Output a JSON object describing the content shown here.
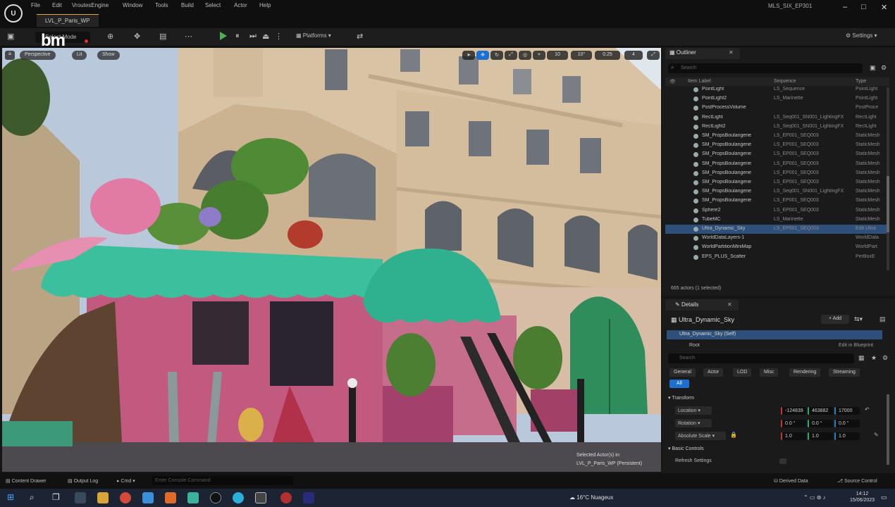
{
  "title_bar": {
    "menu": [
      "File",
      "Edit",
      "Window",
      "Tools",
      "Build",
      "Select",
      "Actor",
      "Help"
    ],
    "menu_partial": "VroutesEngine",
    "level_tab": "LVL_P_Paris_WP",
    "project": "MLS_SIX_EP301"
  },
  "toolbar": {
    "mode": "Select Mode",
    "watermark": "bm",
    "platforms": "Platforms",
    "settings": "Settings"
  },
  "viewport": {
    "perspective": "Perspective",
    "lit": "Lit",
    "show": "Show",
    "grid_snap": "10",
    "angle_snap": "10°",
    "scale_snap": "0.25",
    "camera_speed": "4",
    "overlay_line1": "Selected Actor(s) in:",
    "overlay_line2": "LVL_P_Paris_WP (Persistent)"
  },
  "outliner": {
    "tab": "Outliner",
    "search_placeholder": "Search",
    "col_item": "Item Label",
    "col_sequence": "Sequence",
    "col_type": "Type",
    "rows": [
      {
        "name": "PointLight",
        "seq": "LS_Sequence",
        "type": "PointLight"
      },
      {
        "name": "PointLight2",
        "seq": "LS_Marinette",
        "type": "PointLight"
      },
      {
        "name": "PostProcessVolume",
        "seq": "",
        "type": "PostProce"
      },
      {
        "name": "RectLight",
        "seq": "LS_Seq001_SN001_LightingFX",
        "type": "RectLight"
      },
      {
        "name": "RectLight2",
        "seq": "LS_Seq001_SN001_LightingFX",
        "type": "RectLight"
      },
      {
        "name": "SM_PropsBoulangerie",
        "seq": "LS_EP001_SEQ003",
        "type": "StaticMesh"
      },
      {
        "name": "SM_PropsBoulangerie",
        "seq": "LS_EP001_SEQ003",
        "type": "StaticMesh"
      },
      {
        "name": "SM_PropsBoulangerie",
        "seq": "LS_EP001_SEQ003",
        "type": "StaticMesh"
      },
      {
        "name": "SM_PropsBoulangerie",
        "seq": "LS_EP001_SEQ003",
        "type": "StaticMesh"
      },
      {
        "name": "SM_PropsBoulangerie",
        "seq": "LS_EP001_SEQ003",
        "type": "StaticMesh"
      },
      {
        "name": "SM_PropsBoulangerie",
        "seq": "LS_EP001_SEQ003",
        "type": "StaticMesh"
      },
      {
        "name": "SM_PropsBoulangerie",
        "seq": "LS_Seq001_SN001_LightingFX",
        "type": "StaticMesh"
      },
      {
        "name": "SM_PropsBoulangerie",
        "seq": "LS_EP001_SEQ003",
        "type": "StaticMesh"
      },
      {
        "name": "Sphere2",
        "seq": "LS_EP001_SEQ003",
        "type": "StaticMesh"
      },
      {
        "name": "TubeMC",
        "seq": "LS_Marinette",
        "type": "StaticMesh"
      },
      {
        "name": "Ultra_Dynamic_Sky",
        "seq": "LS_EP001_SEQ003",
        "type": "Edit Ultra"
      },
      {
        "name": "WorldDataLayers-1",
        "seq": "",
        "type": "WorldData"
      },
      {
        "name": "WorldPartitionMiniMap",
        "seq": "",
        "type": "WorldPart"
      },
      {
        "name": "EPS_PLUS_Scatter",
        "seq": "",
        "type": "PerBoxE"
      }
    ],
    "actors_count": "665 actors (1 selected)"
  },
  "details": {
    "tab": "Details",
    "object": "Ultra_Dynamic_Sky",
    "add": "+ Add",
    "self_row": "Ultra_Dynamic_Sky (Self)",
    "root_row": "Root",
    "edit_blueprint": "Edit in Blueprint",
    "search_placeholder": "Search",
    "categories": [
      "General",
      "Actor",
      "LOD",
      "Misc",
      "Rendering",
      "Streaming"
    ],
    "all": "All",
    "transform_label": "Transform",
    "location_label": "Location",
    "rotation_label": "Rotation",
    "scale_label": "Absolute Scale",
    "location": [
      "-124839",
      "463882",
      "17000"
    ],
    "rotation": [
      "0.0 °",
      "0.0 °",
      "0.0 °"
    ],
    "scale": [
      "1.0",
      "1.0",
      "1.0"
    ],
    "basic_controls": "Basic Controls",
    "refresh_settings": "Refresh Settings"
  },
  "bottom_bar": {
    "content_drawer": "Content Drawer",
    "output_log": "Output Log",
    "cmd": "Cmd",
    "console_placeholder": "Enter Console Command",
    "derived_data": "Derived Data",
    "source_control": "Source Control"
  },
  "taskbar": {
    "weather": "16°C Nuageux",
    "time": "14:12",
    "date": "15/06/2023"
  }
}
